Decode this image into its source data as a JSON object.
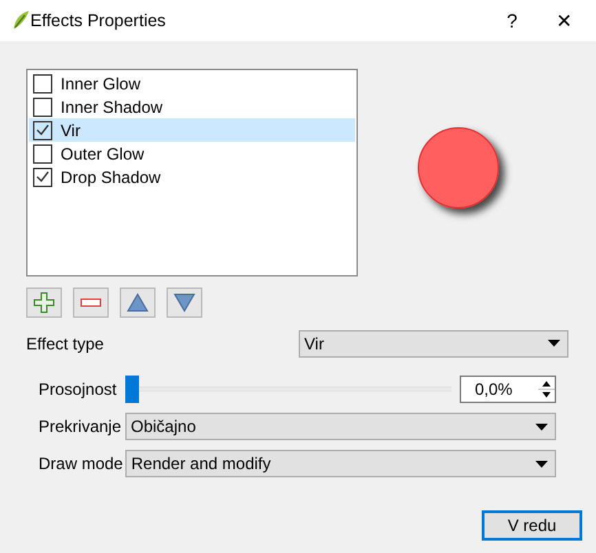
{
  "window": {
    "title": "Effects Properties",
    "help": "?",
    "close": "✕"
  },
  "effects": [
    {
      "label": "Inner Glow",
      "checked": false,
      "selected": false
    },
    {
      "label": "Inner Shadow",
      "checked": false,
      "selected": false
    },
    {
      "label": "Vir",
      "checked": true,
      "selected": true
    },
    {
      "label": "Outer Glow",
      "checked": false,
      "selected": false
    },
    {
      "label": "Drop Shadow",
      "checked": true,
      "selected": false
    }
  ],
  "toolbar": [
    {
      "kind": "add"
    },
    {
      "kind": "remove"
    },
    {
      "kind": "up"
    },
    {
      "kind": "down"
    }
  ],
  "effect_type": {
    "label": "Effect type",
    "value": "Vir"
  },
  "opacity": {
    "label": "Prosojnost",
    "level": 0,
    "reading": "0,0%"
  },
  "blend": {
    "label": "Prekrivanje",
    "value": "Običajno"
  },
  "draw_mode": {
    "label": "Draw mode",
    "value": "Render and modify"
  },
  "ok_button": "V redu"
}
